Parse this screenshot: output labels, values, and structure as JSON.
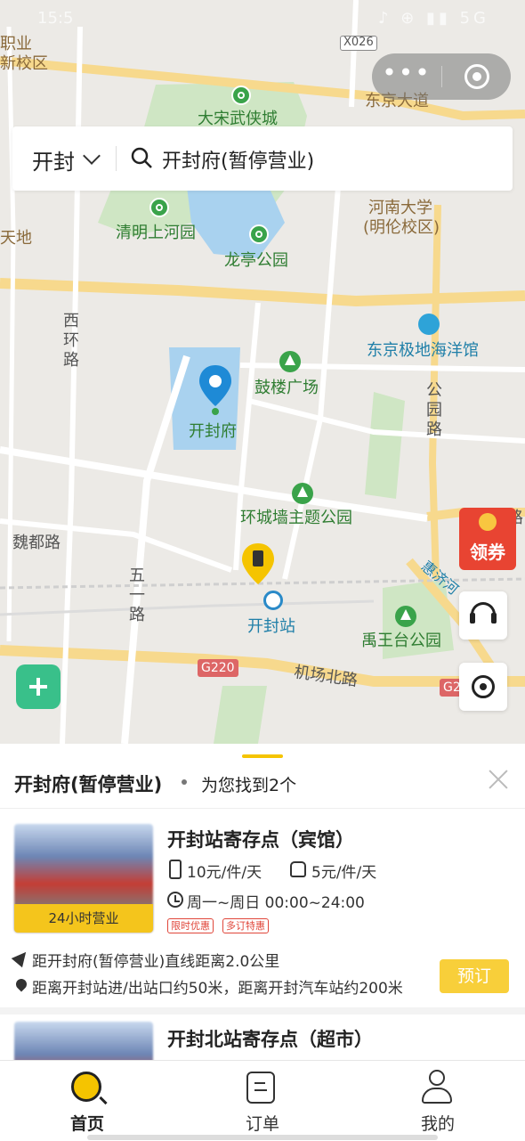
{
  "status_bar": {
    "time": "15:5",
    "icons": "♪ ⊕ ▮▮ 5G"
  },
  "map": {
    "labels": {
      "vocational": "职业",
      "new_campus": "新校区",
      "road_code": "X026",
      "dongjing_road": "东京大道",
      "song_city": "大宋武侠城",
      "tiandi": "天地",
      "qingming": "清明上河园",
      "longting": "龙亭公园",
      "henan_univ": "河南大学",
      "minglun": "(明伦校区)",
      "xihuan_road": "西环路",
      "ocean_park": "东京极地海洋馆",
      "drum_tower": "鼓楼广场",
      "gongyuan_road": "公园路",
      "kaifeng_fu": "开封府",
      "city_wall_park": "环城墙主题公园",
      "weidu_road": "魏都路",
      "wuyi_road": "五一路",
      "huixing_river": "惠济河",
      "kaifeng_station": "开封站",
      "yuwangtai": "禹王台公园",
      "g220": "G220",
      "airport_north_road": "机场北路",
      "g2": "G2",
      "lu_edge": "路"
    }
  },
  "capsule": {
    "menu_icon": "more-dots",
    "close_icon": "target-circle"
  },
  "search": {
    "city": "开封",
    "query": "开封府(暂停营业)"
  },
  "coupon": {
    "label": "领券"
  },
  "sheet": {
    "title": "开封府(暂停营业)",
    "count_text": "为您找到2个",
    "results": [
      {
        "name": "开封站寄存点（宾馆）",
        "badge": "24小时营业",
        "price_luggage": "10元/件/天",
        "price_bag": "5元/件/天",
        "hours": "周一~周日 00:00~24:00",
        "tags": [
          "限时优惠",
          "多订特惠"
        ],
        "distance": "距开封府(暂停营业)直线距离2.0公里",
        "address": "距离开封站进/出站口约50米，距离开封汽车站约200米",
        "book_label": "预订"
      },
      {
        "name": "开封北站寄存点（超市）"
      }
    ]
  },
  "tabbar": {
    "tabs": [
      {
        "label": "首页",
        "icon": "search-icon",
        "active": true
      },
      {
        "label": "订单",
        "icon": "order-icon",
        "active": false
      },
      {
        "label": "我的",
        "icon": "user-icon",
        "active": false
      }
    ]
  },
  "colors": {
    "accent": "#f5c400",
    "book_button": "#f8cf3a",
    "shield": "#39c08a",
    "coupon": "#e84432"
  }
}
